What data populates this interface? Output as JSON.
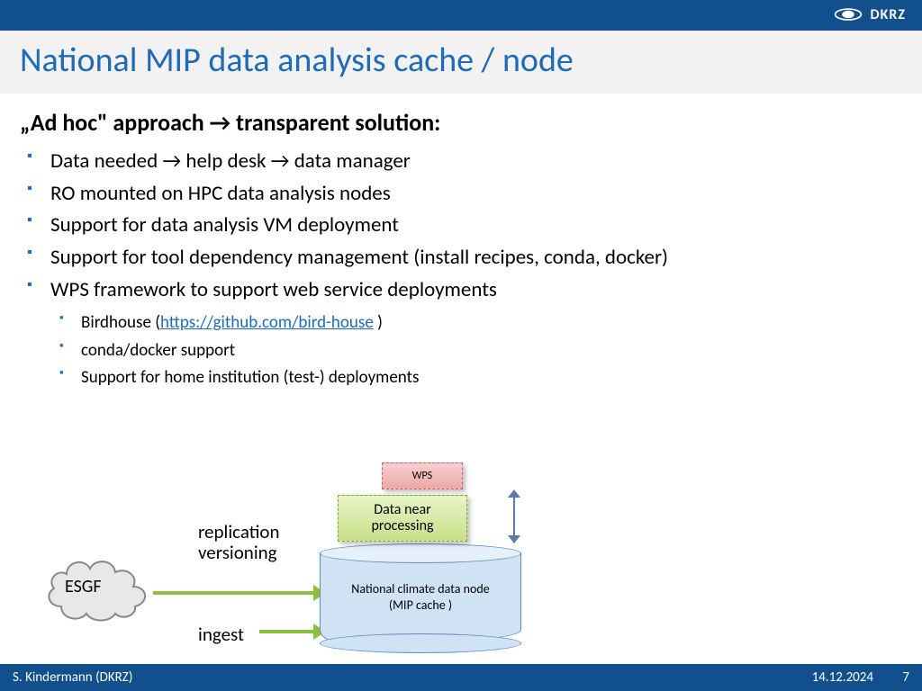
{
  "header": {
    "org": "DKRZ"
  },
  "title": "National MIP data analysis cache / node",
  "heading": {
    "part1": "„Ad hoc\" approach ",
    "arrow": "→",
    "part2": " transparent solution:"
  },
  "bullets": [
    {
      "text": "Data needed → help desk → data manager"
    },
    {
      "text": "RO mounted on HPC data analysis nodes"
    },
    {
      "text": "Support for data analysis VM deployment"
    },
    {
      "text": "Support for tool dependency management (install recipes, conda, docker)"
    },
    {
      "text": "WPS framework to support web service deployments"
    }
  ],
  "sub": [
    {
      "label": "Birdhouse (",
      "link": "https://github.com/bird-house",
      "after": " )"
    },
    {
      "label": "conda/docker support"
    },
    {
      "label": "Support for home institution (test-) deployments"
    }
  ],
  "diagram": {
    "cloud": "ESGF",
    "repl": "replication\nversioning",
    "ingest": "ingest",
    "wps": "WPS",
    "proc": "Data near\nprocessing",
    "node": "National climate data node\n(MIP cache )"
  },
  "footer": {
    "author": "S. Kindermann (DKRZ)",
    "date": "14.12.2024",
    "page": "7"
  }
}
